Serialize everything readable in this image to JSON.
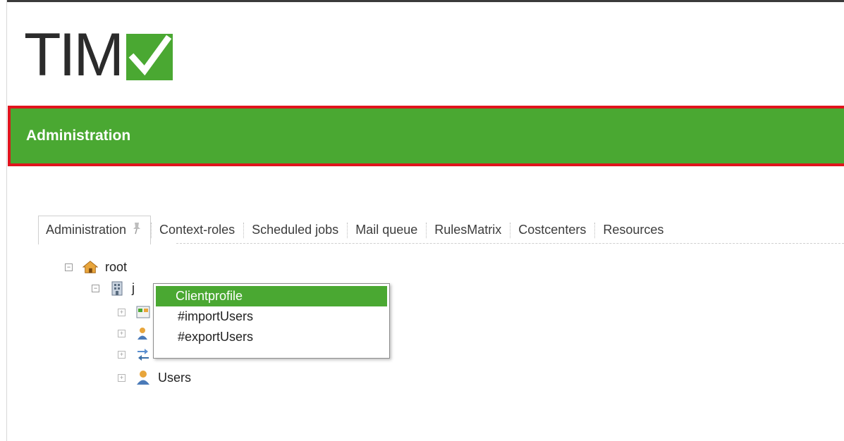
{
  "brand": {
    "logo_text": "TIM",
    "check_color": "#4aa832",
    "accent_color": "#4aa832",
    "highlight_border_color": "#e0141d"
  },
  "header": {
    "title": "Administration"
  },
  "tabs": [
    {
      "label": "Administration",
      "active": true,
      "icon": "pin-icon"
    },
    {
      "label": "Context-roles"
    },
    {
      "label": "Scheduled jobs"
    },
    {
      "label": "Mail queue"
    },
    {
      "label": "RulesMatrix"
    },
    {
      "label": "Costcenters"
    },
    {
      "label": "Resources"
    }
  ],
  "tree": {
    "root": {
      "label": "root",
      "icon": "house-icon",
      "expanded": true
    },
    "child": {
      "label_partial": "j",
      "icon": "building-icon",
      "expanded": true
    },
    "leaves": [
      {
        "icon": "clientprofile-icon"
      },
      {
        "icon": "users-import-icon"
      },
      {
        "icon": "arrows-icon"
      },
      {
        "label": "Users",
        "icon": "user-icon"
      }
    ]
  },
  "context_menu": {
    "items": [
      {
        "label": "Clientprofile",
        "selected": true
      },
      {
        "label": "#importUsers"
      },
      {
        "label": "#exportUsers"
      }
    ]
  }
}
